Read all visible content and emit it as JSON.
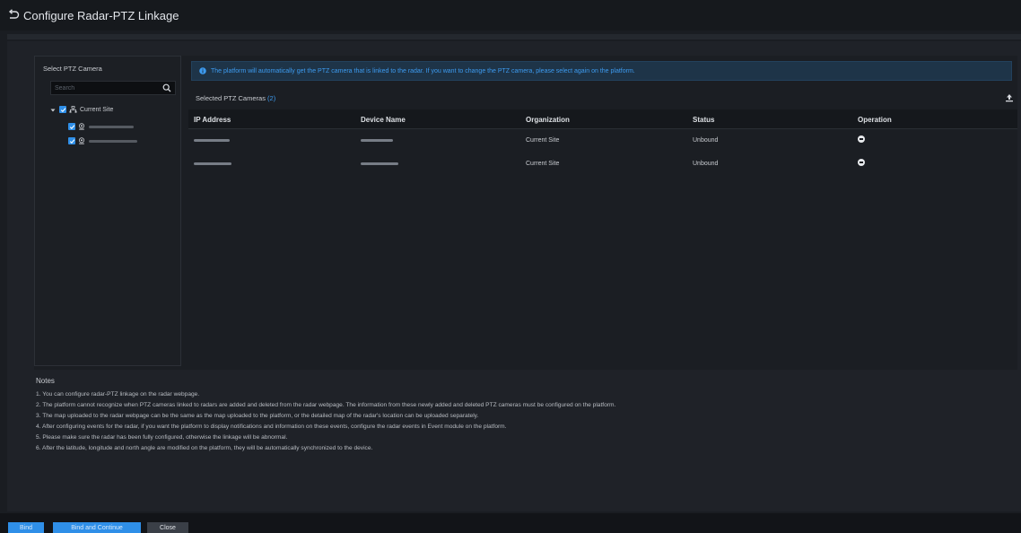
{
  "window": {
    "title": "Configure Radar-PTZ Linkage",
    "back_icon": "back-arrow-icon"
  },
  "left_pane": {
    "title": "Select PTZ Camera",
    "search": {
      "placeholder": "Search",
      "value": "",
      "icon": "search-icon"
    },
    "tree": {
      "root": {
        "label": "Current Site",
        "checked": true,
        "expanded": true,
        "icon": "site-icon"
      },
      "children": [
        {
          "label_redacted": true,
          "checked": true,
          "icon": "camera-icon"
        },
        {
          "label_redacted": true,
          "checked": true,
          "icon": "camera-icon"
        }
      ]
    }
  },
  "info_bar": {
    "icon": "info-icon",
    "text": "The platform will automatically get the PTZ camera that is linked to the radar. If you want to change the PTZ camera, please select again on the platform."
  },
  "selected": {
    "label": "Selected PTZ Cameras",
    "count": "(2)",
    "export_icon": "export-icon"
  },
  "table": {
    "columns": [
      "IP Address",
      "Device Name",
      "Organization",
      "Status",
      "Operation"
    ],
    "rows": [
      {
        "ip_redacted": true,
        "name_redacted": true,
        "organization": "Current Site",
        "status": "Unbound",
        "operation_icon": "remove-icon"
      },
      {
        "ip_redacted": true,
        "name_redacted": true,
        "organization": "Current Site",
        "status": "Unbound",
        "operation_icon": "remove-icon"
      }
    ]
  },
  "notes": {
    "title": "Notes",
    "lines": [
      "1. You can configure radar-PTZ linkage on the radar webpage.",
      "2. The platform cannot recognize when PTZ cameras linked to radars are added and deleted from the radar webpage. The information from these newly added and deleted PTZ cameras must be configured on the platform.",
      "3. The map uploaded to the radar webpage can be the same as the map uploaded to the platform, or the detailed map of the radar's location can be uploaded separately.",
      "4. After configuring events for the radar, if you want the platform to display notifications and information on these events, configure the radar events in Event module on the platform.",
      "5. Please make sure the radar has been fully configured, otherwise the linkage will be abnormal.",
      "6. After the latitude, longitude and north angle are modified on the platform, they will be automatically synchronized to the device."
    ]
  },
  "footer": {
    "bind_label": "Bind",
    "bind_continue_label": "Bind and Continue",
    "close_label": "Close"
  },
  "colors": {
    "accent": "#2f8fe8",
    "info_text": "#3d9bf0",
    "background": "#1a1d22"
  }
}
